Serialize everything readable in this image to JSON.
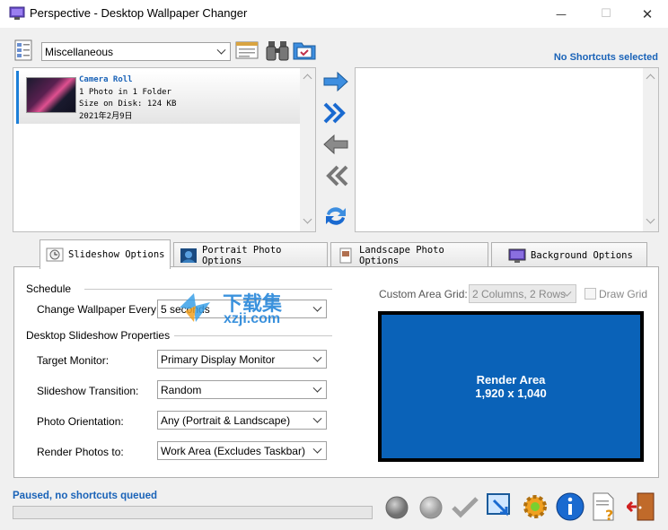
{
  "window": {
    "title": "Perspective - Desktop Wallpaper Changer",
    "minimize_glyph": "—",
    "maximize_glyph": "☐",
    "close_glyph": "✕"
  },
  "toolbar": {
    "category_value": "Miscellaneous",
    "icons": [
      "list-icon",
      "slideshow-icon",
      "binoculars-icon",
      "folder-icon"
    ]
  },
  "shortcuts": {
    "label": "No Shortcuts selected"
  },
  "album": {
    "title": "Camera Roll",
    "photos": "1 Photo in 1 Folder",
    "size": "Size on Disk: 124 KB",
    "date": "2021年2月9日"
  },
  "tabs": [
    {
      "label": "Slideshow Options",
      "icon": "clock-icon",
      "active": true
    },
    {
      "label": "Portrait Photo Options",
      "icon": "portrait-icon",
      "active": false
    },
    {
      "label": "Landscape Photo Options",
      "icon": "landscape-icon",
      "active": false
    },
    {
      "label": "Background Options",
      "icon": "monitor-icon",
      "active": false
    }
  ],
  "schedule": {
    "heading": "Schedule",
    "change_label": "Change Wallpaper Every:",
    "change_value": "5 seconds"
  },
  "desktop": {
    "heading": "Desktop Slideshow Properties",
    "target_label": "Target Monitor:",
    "target_value": "Primary Display Monitor",
    "transition_label": "Slideshow Transition:",
    "transition_value": "Random",
    "orientation_label": "Photo Orientation:",
    "orientation_value": "Any (Portrait & Landscape)",
    "render_label": "Render Photos to:",
    "render_value": "Work Area (Excludes Taskbar)"
  },
  "grid": {
    "label": "Custom Area Grid:",
    "value": "2 Columns, 2 Rows",
    "draw_grid": "Draw Grid"
  },
  "render_area": {
    "title": "Render Area",
    "size": "1,920 x 1,040"
  },
  "status": {
    "text": "Paused, no shortcuts queued",
    "progress": 0
  },
  "watermark": {
    "cn": "下载集",
    "url": "xzji.com"
  },
  "colors": {
    "accent": "#1a63b8",
    "render_bg": "#0a62b8",
    "selection_bar": "#1c7fd8"
  }
}
